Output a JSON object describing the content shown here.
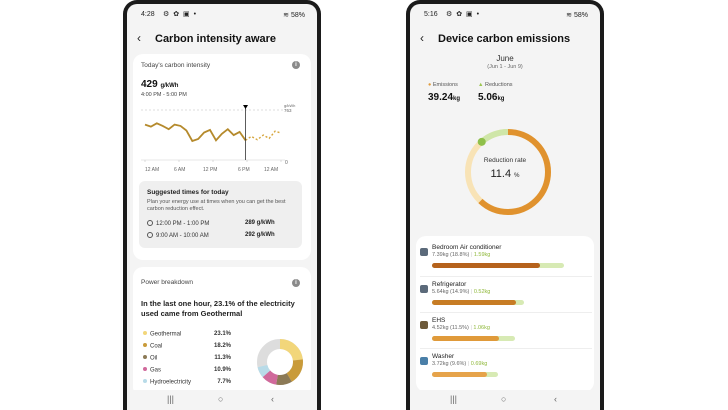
{
  "left": {
    "status": {
      "time": "4:28",
      "battery": "58%"
    },
    "title": "Carbon intensity aware",
    "intensity_card": {
      "label": "Today's carbon intensity",
      "value": "429",
      "unit": "g/kWh",
      "time_range": "4:00 PM - 5:00 PM",
      "y_top_label": "g/kWh",
      "y_top_value": "763",
      "y_zero": "0",
      "x_ticks": [
        "12 AM",
        "6 AM",
        "12 PM",
        "6 PM",
        "12 AM"
      ]
    },
    "chart_data": {
      "type": "line",
      "title": "Today's carbon intensity",
      "ylabel": "g/kWh",
      "ylim": [
        0,
        763
      ],
      "x_ticks": [
        "12 AM",
        "6 AM",
        "12 PM",
        "6 PM",
        "12 AM"
      ],
      "series": [
        {
          "values_hourly": [
            540,
            510,
            560,
            520,
            470,
            540,
            520,
            450,
            290,
            320,
            420,
            460,
            300,
            400,
            470,
            380,
            429,
            300,
            360,
            310,
            380,
            330,
            440,
            410
          ],
          "forecast_from_hour": 17
        }
      ]
    },
    "suggest": {
      "heading": "Suggested times for today",
      "desc": "Plan your energy use at times when you can get the best carbon reduction effect.",
      "rows": [
        {
          "time": "12:00 PM - 1:00 PM",
          "value": "289 g/kWh"
        },
        {
          "time": "9:00 AM - 10:00 AM",
          "value": "292 g/kWh"
        }
      ]
    },
    "power": {
      "label": "Power breakdown",
      "text": "In the last one hour, 23.1% of the electricity used came from Geothermal",
      "items": [
        {
          "name": "Geothermal",
          "pct": "23.1%",
          "color": "#f2d67a",
          "value": 23.1
        },
        {
          "name": "Coal",
          "pct": "18.2%",
          "color": "#c99b3a",
          "value": 18.2
        },
        {
          "name": "Oil",
          "pct": "11.3%",
          "color": "#8c7a56",
          "value": 11.3
        },
        {
          "name": "Gas",
          "pct": "10.9%",
          "color": "#d0699b",
          "value": 10.9
        },
        {
          "name": "Hydroelectricity",
          "pct": "7.7%",
          "color": "#b8dbe8",
          "value": 7.7
        }
      ]
    }
  },
  "right": {
    "status": {
      "time": "5:16",
      "battery": "58%"
    },
    "title": "Device carbon emissions",
    "month": "June",
    "period": "(Jun 1 - Jun 9)",
    "emissions_label": "Emissions",
    "emissions_value": "39.24",
    "reductions_label": "Reductions",
    "reductions_value": "5.06",
    "kg": "kg",
    "reduction_rate_label": "Reduction rate",
    "reduction_rate_value": "11.4",
    "reduction_rate_unit": "%",
    "reduction_fraction": 0.114,
    "devices": [
      {
        "name": "Bedroom Air conditioner",
        "emission": "7.39kg (18.8%)",
        "reduction": "1.59kg",
        "e_frac": 0.82,
        "r_frac": 0.18
      },
      {
        "name": "Refrigerator",
        "emission": "5.64kg (14.9%)",
        "reduction": "0.52kg",
        "e_frac": 0.64,
        "r_frac": 0.06
      },
      {
        "name": "EHS",
        "emission": "4.52kg (11.5%)",
        "reduction": "1.06kg",
        "e_frac": 0.51,
        "r_frac": 0.12
      },
      {
        "name": "Washer",
        "emission": "3.72kg (9.6%)",
        "reduction": "0.69kg",
        "e_frac": 0.42,
        "r_frac": 0.08
      }
    ]
  }
}
